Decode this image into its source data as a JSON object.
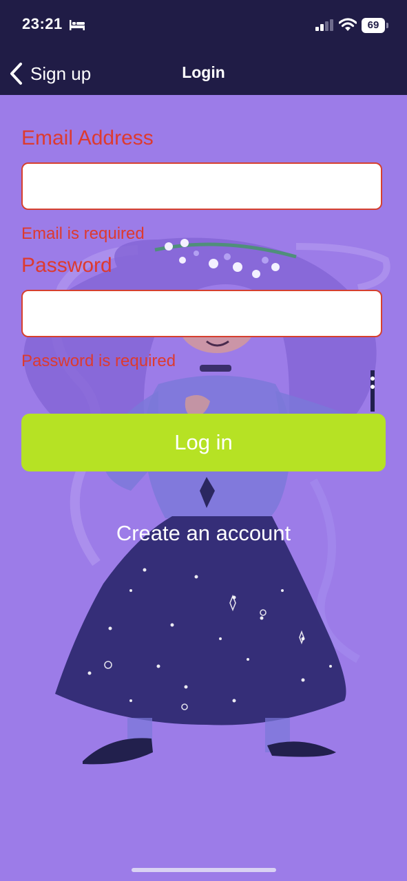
{
  "status_bar": {
    "time": "23:21",
    "battery": "69",
    "icons": [
      "bed-icon",
      "signal-icon",
      "wifi-icon",
      "battery-icon"
    ]
  },
  "nav": {
    "back_label": "Sign up",
    "title": "Login",
    "back_icon": "chevron-left-icon"
  },
  "form": {
    "email": {
      "label": "Email Address",
      "value": "",
      "placeholder": "",
      "error": "Email is required"
    },
    "password": {
      "label": "Password",
      "value": "",
      "placeholder": "",
      "error": "Password is required"
    },
    "login_label": "Log in",
    "create_account_label": "Create an account"
  },
  "colors": {
    "header_bg": "#201c46",
    "page_bg": "#9c7ce8",
    "error": "#dd3a2f",
    "login_button": "#b6e224",
    "link": "#ffffff"
  }
}
